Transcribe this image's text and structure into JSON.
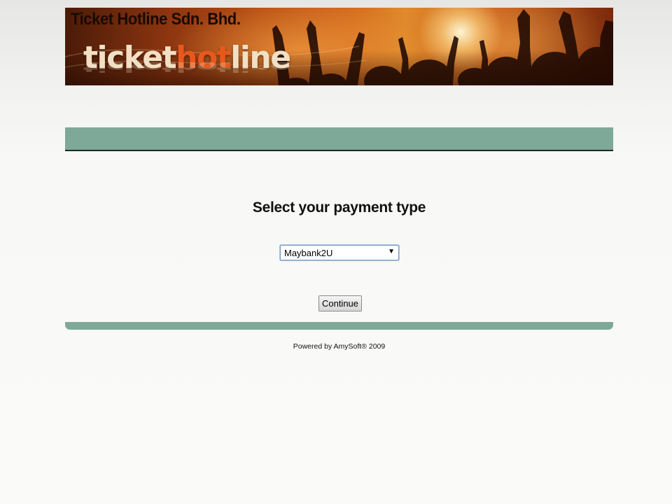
{
  "banner": {
    "company_name": "Ticket Hotline Sdn. Bhd.",
    "logo": {
      "part1": "ticket",
      "part2": "hot",
      "part3": "line"
    }
  },
  "main": {
    "heading": "Select your payment type",
    "payment_select": {
      "selected": "Maybank2U"
    },
    "continue_label": "Continue"
  },
  "footer": {
    "powered_by": "Powered by AmySoft® 2009"
  },
  "colors": {
    "bar_green": "#7ea898",
    "logo_accent": "#e8581c",
    "banner_orange": "#d36a1d"
  }
}
